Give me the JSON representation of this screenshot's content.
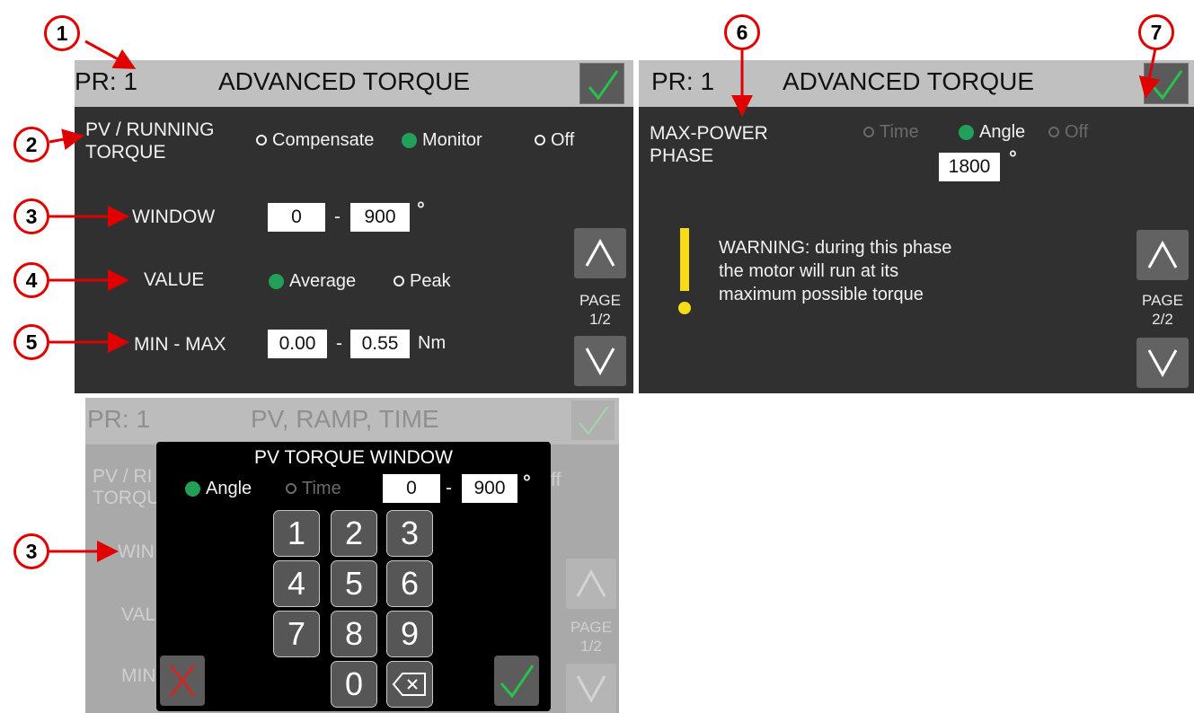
{
  "callouts": [
    "1",
    "2",
    "3",
    "4",
    "5",
    "6",
    "7",
    "3"
  ],
  "screen1": {
    "pr": "PR: 1",
    "title": "ADVANCED TORQUE",
    "pv_label_line1": "PV / RUNNING",
    "pv_label_line2": "TORQUE",
    "pv_options": [
      {
        "label": "Compensate",
        "selected": false
      },
      {
        "label": "Monitor",
        "selected": true
      },
      {
        "label": "Off",
        "selected": false
      }
    ],
    "window_label": "WINDOW",
    "window_from": "0",
    "window_sep": "-",
    "window_to": "900",
    "window_unit": "°",
    "value_label": "VALUE",
    "value_options": [
      {
        "label": "Average",
        "selected": true
      },
      {
        "label": "Peak",
        "selected": false
      }
    ],
    "minmax_label": "MIN - MAX",
    "min": "0.00",
    "minmax_sep": "-",
    "max": "0.55",
    "minmax_unit": "Nm",
    "page_line1": "PAGE",
    "page_line2": "1/2"
  },
  "screen2": {
    "pr": "PR: 1",
    "title": "ADVANCED TORQUE",
    "phase_label_line1": "MAX-POWER",
    "phase_label_line2": "PHASE",
    "phase_options": [
      {
        "label": "Time",
        "selected": false,
        "enabled": false
      },
      {
        "label": "Angle",
        "selected": true,
        "enabled": true
      },
      {
        "label": "Off",
        "selected": false,
        "enabled": false
      }
    ],
    "angle_value": "1800",
    "angle_unit": "°",
    "warning_mark": "!",
    "warning_line1": "WARNING: during this phase",
    "warning_line2": "the motor will run at its",
    "warning_line3": "maximum possible torque",
    "page_line1": "PAGE",
    "page_line2": "2/2"
  },
  "screen3": {
    "pr": "PR: 1",
    "title": "PV, RAMP, TIME",
    "bg_pv_line1": "PV / RI",
    "bg_pv_line2": "TORQU",
    "bg_off": "ff",
    "bg_window": "WIN",
    "bg_value": "VAL",
    "bg_min": "MIN",
    "page_line1": "PAGE",
    "page_line2": "1/2",
    "dialog": {
      "title": "PV TORQUE WINDOW",
      "options": [
        {
          "label": "Angle",
          "selected": true
        },
        {
          "label": "Time",
          "selected": false
        }
      ],
      "from": "0",
      "sep": "-",
      "to": "900",
      "unit": "°",
      "keys": [
        "1",
        "2",
        "3",
        "4",
        "5",
        "6",
        "7",
        "8",
        "9",
        "0"
      ]
    }
  },
  "colors": {
    "screen_bg": "#303030",
    "title_bar": "#c0c0c0",
    "selected_radio": "#22a05a",
    "confirm_check": "#27c24c",
    "cancel_x": "#e02020",
    "warning": "#f7dc16",
    "callout": "#e00000"
  }
}
